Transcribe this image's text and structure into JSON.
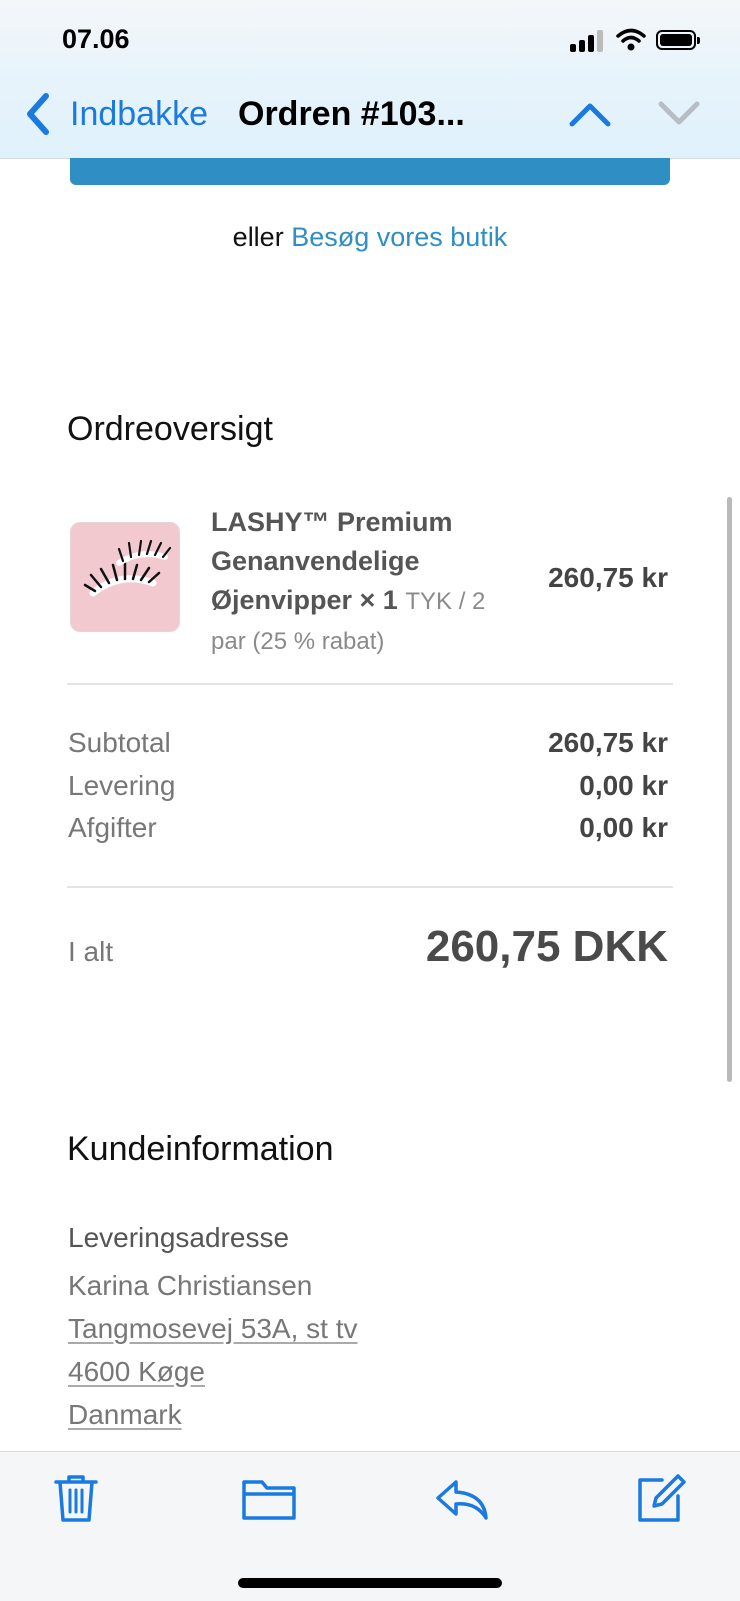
{
  "status_bar": {
    "time": "07.06"
  },
  "nav": {
    "back_label": "Indbakke",
    "title": "Ordren #103..."
  },
  "colors": {
    "accent": "#1a7ae0",
    "shop_blue": "#2f8ec4",
    "muted_text": "#777777"
  },
  "cta": {
    "or_text": "eller",
    "shop_link": "Besøg vores butik"
  },
  "order_summary": {
    "heading": "Ordreoversigt",
    "item": {
      "name": "LASHY™ Premium Genanvendelige Øjenvipper × 1",
      "variant": "TYK / 2 par (25 % rabat)",
      "price": "260,75 kr"
    },
    "rows": [
      {
        "label": "Subtotal",
        "value": "260,75 kr"
      },
      {
        "label": "Levering",
        "value": "0,00 kr"
      },
      {
        "label": "Afgifter",
        "value": "0,00 kr"
      }
    ],
    "total_label": "I alt",
    "total_value": "260,75 DKK"
  },
  "customer": {
    "heading": "Kundeinformation",
    "address_heading": "Leveringsadresse",
    "name": "Karina Christiansen",
    "street": "Tangmosevej 53A, st tv",
    "city": "4600 Køge",
    "country": "Danmark"
  },
  "toolbar": {
    "icons": [
      "trash-icon",
      "folder-icon",
      "reply-icon",
      "compose-icon"
    ]
  }
}
